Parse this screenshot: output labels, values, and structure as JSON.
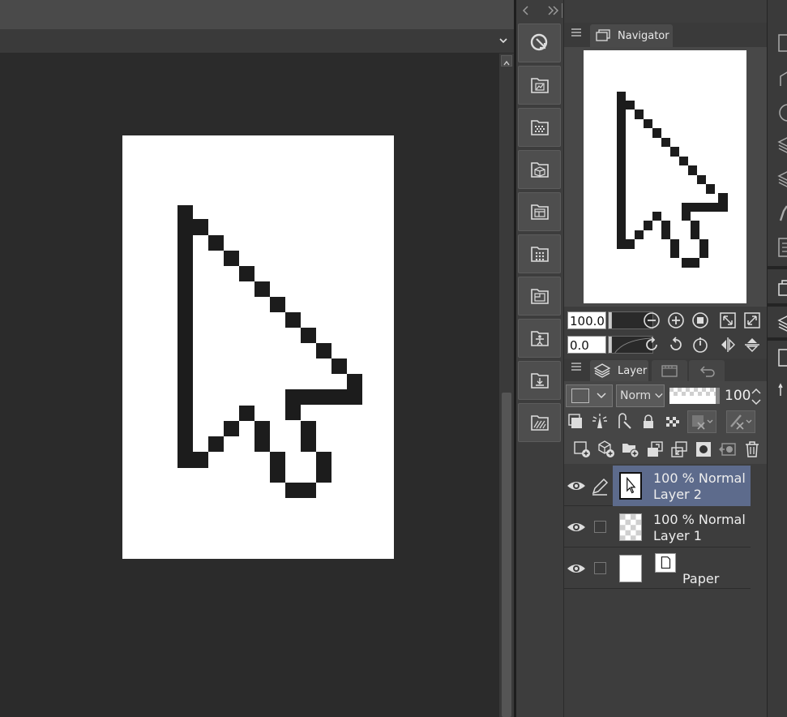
{
  "navigator": {
    "tab_label": "Navigator",
    "zoom_value": "100.0",
    "rotate_value": "0.0"
  },
  "layer_panel": {
    "tab_label": "Layer",
    "blend_mode": "Norm",
    "opacity_value": "100",
    "layers": [
      {
        "opacity_mode": "100 % Normal",
        "name": "Layer 2",
        "selected": true
      },
      {
        "opacity_mode": "100 % Normal",
        "name": "Layer 1",
        "selected": false
      },
      {
        "opacity_mode": "",
        "name": "Paper",
        "selected": false
      }
    ]
  },
  "colors": {
    "selected_layer": "#5d6b8c",
    "background": "#2b2b2b",
    "panel": "#3d3d3d"
  }
}
